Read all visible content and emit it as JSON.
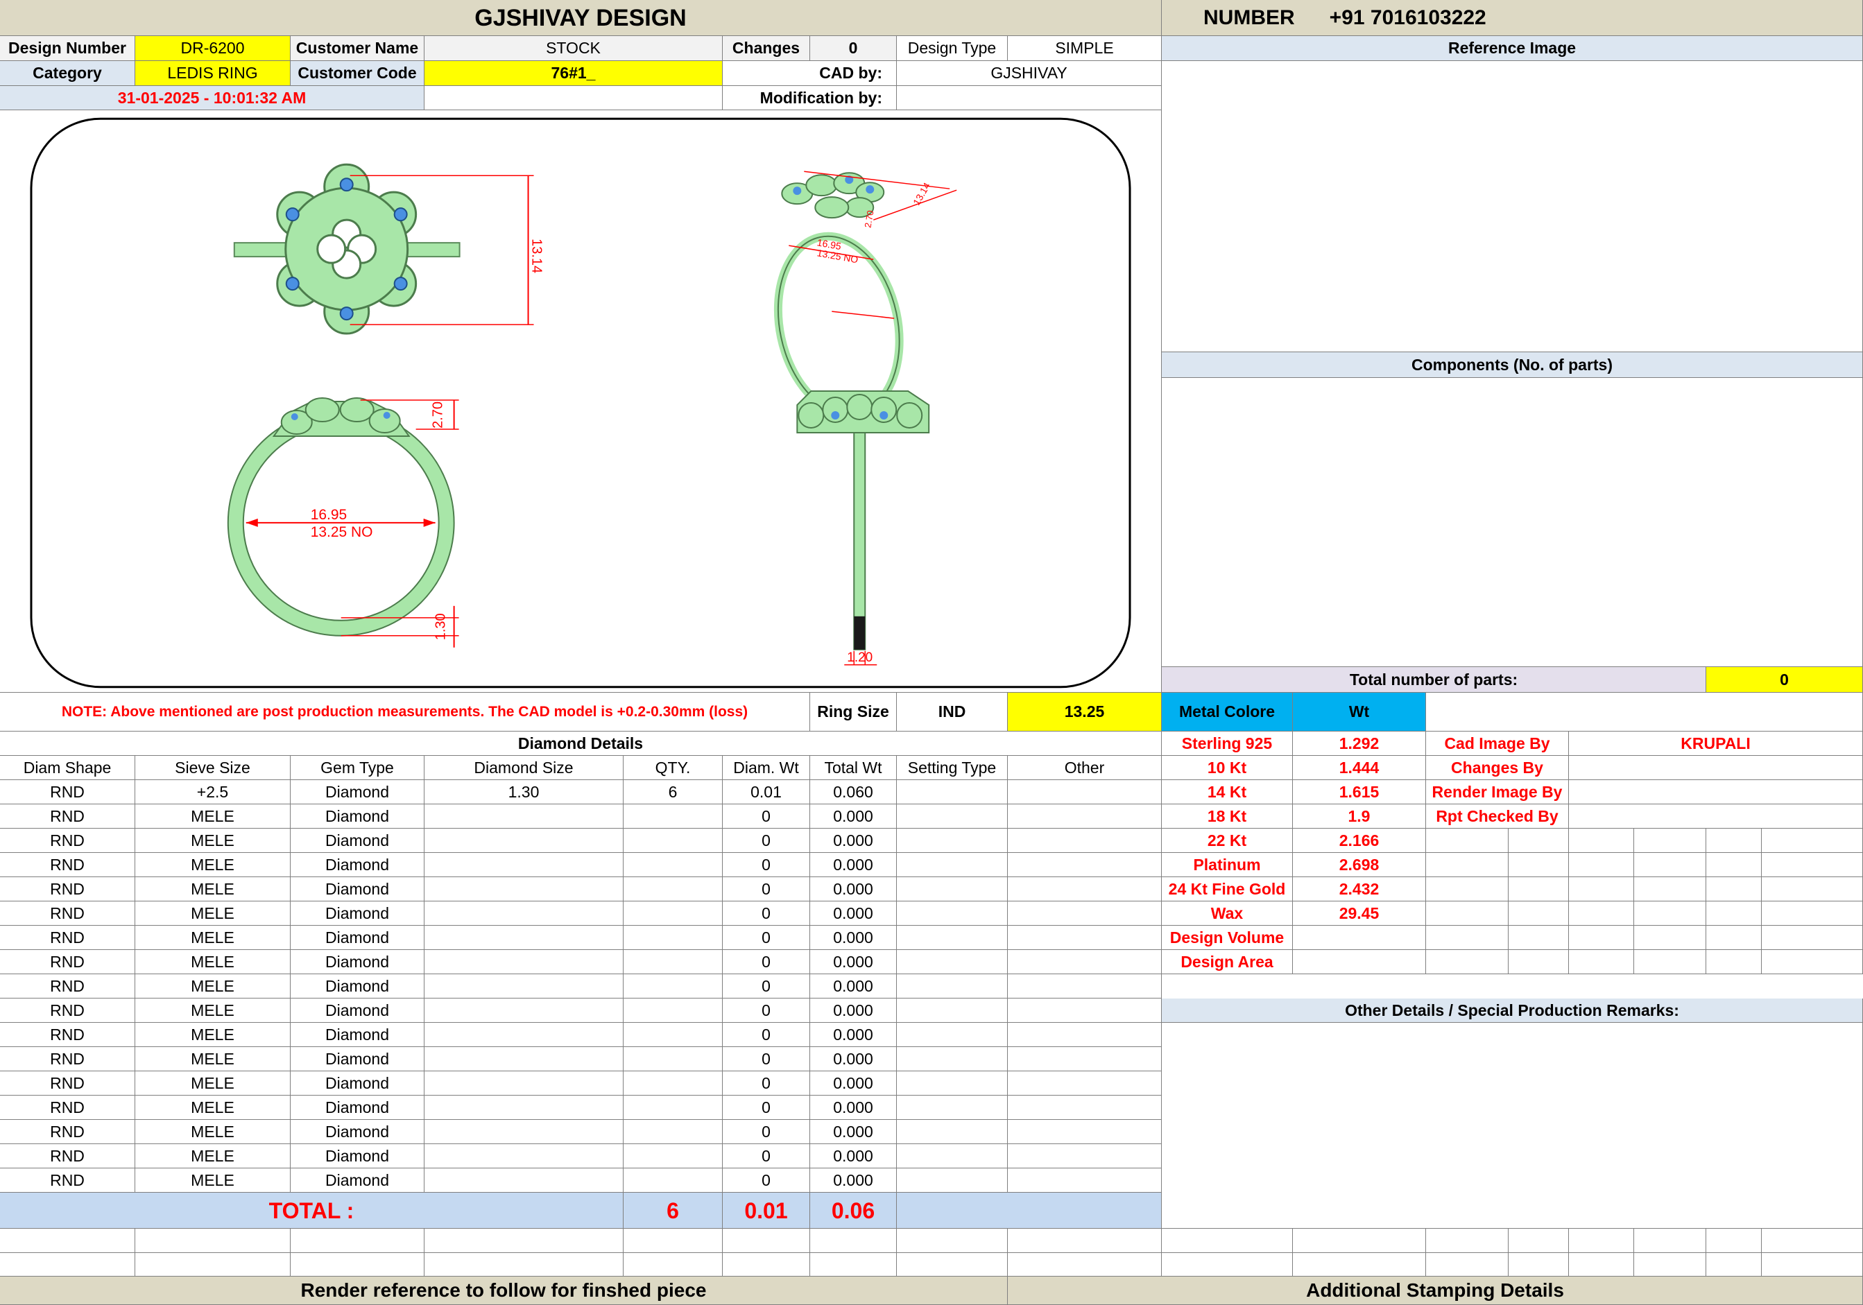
{
  "title": "GJSHIVAY DESIGN",
  "number_label": "NUMBER",
  "number_value": "+91 7016103222",
  "header": {
    "design_number_label": "Design Number",
    "design_number": "DR-6200",
    "customer_name_label": "Customer Name",
    "customer_name": "STOCK",
    "changes_label": "Changes",
    "changes": "0",
    "design_type_label": "Design Type",
    "design_type": "SIMPLE",
    "category_label": "Category",
    "category": "LEDIS RING",
    "customer_code_label": "Customer Code",
    "customer_code": "76#1_",
    "cad_by_label": "CAD by:",
    "cad_by": "GJSHIVAY",
    "datetime": "31-01-2025 - 10:01:32 AM",
    "modification_by_label": "Modification by:",
    "modification_by": ""
  },
  "reference_image_label": "Reference Image",
  "components_label": "Components (No. of parts)",
  "total_parts_label": "Total number of parts:",
  "total_parts": "0",
  "drawing": {
    "top_height": "13.14",
    "top_angle_1": "16.95",
    "top_angle_2": "13.25 NO",
    "top_angle_3": "2.70",
    "side_height": "2.70",
    "inner_diameter": "16.95",
    "ring_size_no": "13.25 NO",
    "band_thickness": "1.30",
    "band_width": "1.20",
    "watermark": "GJSHIVAY"
  },
  "note": "NOTE: Above mentioned are post production measurements. The CAD model is +0.2-0.30mm (loss)",
  "ring_size_label": "Ring Size",
  "ring_size_standard": "IND",
  "ring_size_value": "13.25",
  "metal_header": "Metal Colore",
  "wt_header": "Wt",
  "metals": [
    {
      "name": "Sterling 925",
      "wt": "1.292"
    },
    {
      "name": "10 Kt",
      "wt": "1.444"
    },
    {
      "name": "14 Kt",
      "wt": "1.615"
    },
    {
      "name": "18 Kt",
      "wt": "1.9"
    },
    {
      "name": "22 Kt",
      "wt": "2.166"
    },
    {
      "name": "Platinum",
      "wt": "2.698"
    },
    {
      "name": "24 Kt Fine Gold",
      "wt": "2.432"
    },
    {
      "name": "Wax",
      "wt": "29.45"
    },
    {
      "name": "Design Volume",
      "wt": ""
    },
    {
      "name": "Design Area",
      "wt": ""
    }
  ],
  "credits": [
    {
      "label": "Cad Image By",
      "value": "KRUPALI"
    },
    {
      "label": "Changes By",
      "value": ""
    },
    {
      "label": "Render Image By",
      "value": ""
    },
    {
      "label": "Rpt Checked By",
      "value": ""
    }
  ],
  "diamond_details_label": "Diamond Details",
  "diamond_columns": [
    "Diam Shape",
    "Sieve Size",
    "Gem Type",
    "Diamond Size",
    "QTY.",
    "Diam. Wt",
    "Total Wt",
    "Setting Type",
    "Other"
  ],
  "diamond_rows": [
    [
      "RND",
      "+2.5",
      "Diamond",
      "1.30",
      "6",
      "0.01",
      "0.060",
      "",
      ""
    ],
    [
      "RND",
      "MELE",
      "Diamond",
      "",
      "",
      "0",
      "0.000",
      "",
      ""
    ],
    [
      "RND",
      "MELE",
      "Diamond",
      "",
      "",
      "0",
      "0.000",
      "",
      ""
    ],
    [
      "RND",
      "MELE",
      "Diamond",
      "",
      "",
      "0",
      "0.000",
      "",
      ""
    ],
    [
      "RND",
      "MELE",
      "Diamond",
      "",
      "",
      "0",
      "0.000",
      "",
      ""
    ],
    [
      "RND",
      "MELE",
      "Diamond",
      "",
      "",
      "0",
      "0.000",
      "",
      ""
    ],
    [
      "RND",
      "MELE",
      "Diamond",
      "",
      "",
      "0",
      "0.000",
      "",
      ""
    ],
    [
      "RND",
      "MELE",
      "Diamond",
      "",
      "",
      "0",
      "0.000",
      "",
      ""
    ],
    [
      "RND",
      "MELE",
      "Diamond",
      "",
      "",
      "0",
      "0.000",
      "",
      ""
    ],
    [
      "RND",
      "MELE",
      "Diamond",
      "",
      "",
      "0",
      "0.000",
      "",
      ""
    ],
    [
      "RND",
      "MELE",
      "Diamond",
      "",
      "",
      "0",
      "0.000",
      "",
      ""
    ],
    [
      "RND",
      "MELE",
      "Diamond",
      "",
      "",
      "0",
      "0.000",
      "",
      ""
    ],
    [
      "RND",
      "MELE",
      "Diamond",
      "",
      "",
      "0",
      "0.000",
      "",
      ""
    ],
    [
      "RND",
      "MELE",
      "Diamond",
      "",
      "",
      "0",
      "0.000",
      "",
      ""
    ],
    [
      "RND",
      "MELE",
      "Diamond",
      "",
      "",
      "0",
      "0.000",
      "",
      ""
    ],
    [
      "RND",
      "MELE",
      "Diamond",
      "",
      "",
      "0",
      "0.000",
      "",
      ""
    ],
    [
      "RND",
      "MELE",
      "Diamond",
      "",
      "",
      "0",
      "0.000",
      "",
      ""
    ]
  ],
  "total_label": "TOTAL :",
  "total_qty": "6",
  "total_diam_wt": "0.01",
  "total_wt": "0.06",
  "other_details_label": "Other Details / Special Production Remarks:",
  "render_reference_label": "Render reference to follow for finshed piece",
  "stamping_label": "Additional Stamping Details",
  "colors": {
    "yellow": "#ffff00",
    "tan": "#ddd9c4",
    "blue": "#00b0f0",
    "red": "#ff0000",
    "ring": "#a8e6a8",
    "stone": "#4a90e2"
  }
}
